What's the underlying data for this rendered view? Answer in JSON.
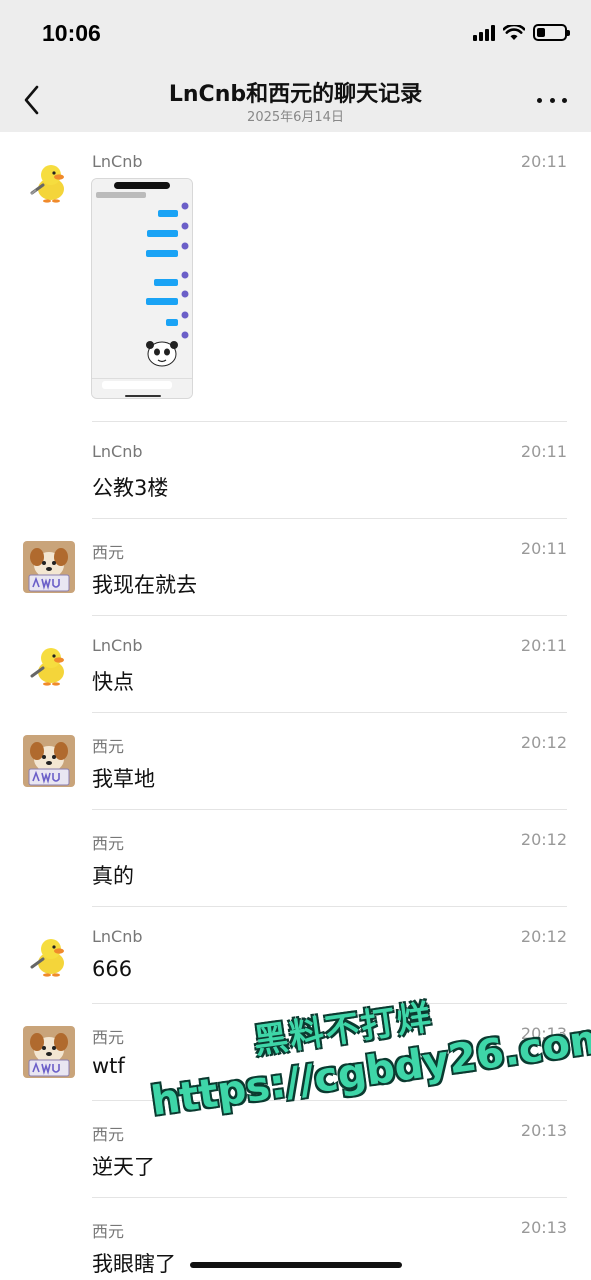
{
  "status_bar": {
    "time": "10:06"
  },
  "header": {
    "title": "LnCnb和西元的聊天记录",
    "date": "2025年6月14日"
  },
  "messages": [
    {
      "sender": "LnCnb",
      "time": "20:11",
      "kind": "image",
      "text": ""
    },
    {
      "sender": "LnCnb",
      "time": "20:11",
      "kind": "text",
      "text": "公教3楼"
    },
    {
      "sender": "西元",
      "time": "20:11",
      "kind": "text",
      "text": "我现在就去"
    },
    {
      "sender": "LnCnb",
      "time": "20:11",
      "kind": "text",
      "text": "快点"
    },
    {
      "sender": "西元",
      "time": "20:12",
      "kind": "text",
      "text": "我草地"
    },
    {
      "sender": "西元",
      "time": "20:12",
      "kind": "text",
      "text": "真的"
    },
    {
      "sender": "LnCnb",
      "time": "20:12",
      "kind": "text",
      "text": "666"
    },
    {
      "sender": "西元",
      "time": "20:13",
      "kind": "text",
      "text": "wtf"
    },
    {
      "sender": "西元",
      "time": "20:13",
      "kind": "text",
      "text": "逆天了"
    },
    {
      "sender": "西元",
      "time": "20:13",
      "kind": "text",
      "text": "我眼瞎了"
    }
  ],
  "watermark": {
    "line1": "黑料不打烊",
    "line2": "https://cgbdy26.com"
  },
  "colors": {
    "header_bg": "#ededed",
    "watermark": "#3ed6a8",
    "chat_bubble_blue": "#1aa3f5"
  }
}
